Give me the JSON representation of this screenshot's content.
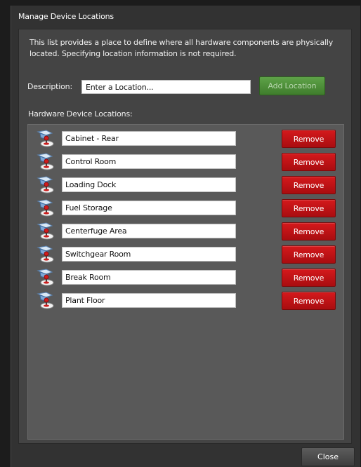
{
  "dialog": {
    "title": "Manage Device Locations",
    "description": "This list provides a place to define where all hardware components are physically located. Specifying location information is not required.",
    "description_label": "Description:",
    "description_input_placeholder": "Enter a Location...",
    "add_button_label": "Add Location",
    "list_label": "Hardware Device Locations:",
    "close_button_label": "Close"
  },
  "locations": [
    {
      "name": "Cabinet - Rear",
      "remove_label": "Remove"
    },
    {
      "name": "Control Room",
      "remove_label": "Remove"
    },
    {
      "name": "Loading Dock",
      "remove_label": "Remove"
    },
    {
      "name": "Fuel Storage",
      "remove_label": "Remove"
    },
    {
      "name": "Centerfuge Area",
      "remove_label": "Remove"
    },
    {
      "name": "Switchgear Room",
      "remove_label": "Remove"
    },
    {
      "name": "Break Room",
      "remove_label": "Remove"
    },
    {
      "name": "Plant Floor",
      "remove_label": "Remove"
    }
  ],
  "icons": {
    "location_row": "location-pin-icon"
  },
  "colors": {
    "add_button": "#4f8f3a",
    "remove_button": "#c81417",
    "close_button": "#4a4a4a"
  }
}
